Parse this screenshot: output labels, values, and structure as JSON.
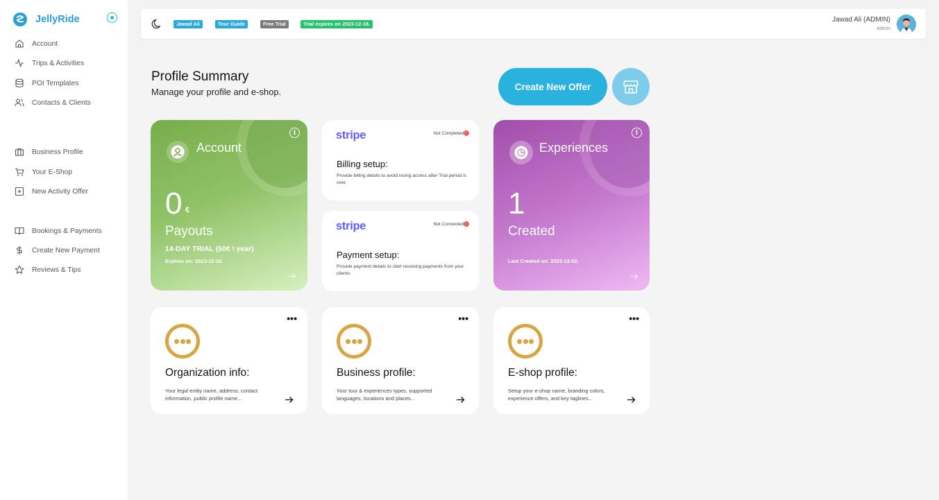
{
  "brand": {
    "name": "JellyRide",
    "accent": "#2a9fd6"
  },
  "sidebar": {
    "items": [
      {
        "label": "Account",
        "icon": "home-icon"
      },
      {
        "label": "Trips & Activities",
        "icon": "activity-icon"
      },
      {
        "label": "POI Templates",
        "icon": "database-icon"
      },
      {
        "label": "Contacts & Clients",
        "icon": "users-icon"
      },
      {
        "label": "Business Profile",
        "icon": "briefcase-icon"
      },
      {
        "label": "Your E-Shop",
        "icon": "cart-icon"
      },
      {
        "label": "New Activity Offer",
        "icon": "plus-square-icon"
      },
      {
        "label": "Bookings & Payments",
        "icon": "book-open-icon"
      },
      {
        "label": "Create New Payment",
        "icon": "dollar-icon"
      },
      {
        "label": "Reviews & Tips",
        "icon": "star-icon"
      }
    ]
  },
  "topbar": {
    "badges": [
      {
        "label": "Jawad Ali",
        "color": "#27a9dd"
      },
      {
        "label": "Tour Guide",
        "color": "#27a9dd"
      },
      {
        "label": "Free Trial",
        "color": "#7a7a7a"
      },
      {
        "label": "Trial expires on 2023-12-18.",
        "color": "#23c26b"
      }
    ],
    "user_name": "Jawad Ali (ADMIN)",
    "user_role": "Admin"
  },
  "page": {
    "title": "Profile Summary",
    "subtitle": "Manage your profile and e-shop.",
    "create_offer_label": "Create New Offer"
  },
  "account_card": {
    "title": "Account",
    "amount": "0",
    "currency": "€",
    "label": "Payouts",
    "trial": "14-DAY TRIAL (50€ \\ year)",
    "expires": "Expires on: 2023-12-16."
  },
  "billing_card": {
    "logo": "stripe",
    "status": "Not Completed",
    "title": "Billing setup:",
    "description": "Provide billing details to avoid losing access after Trial period is over."
  },
  "payment_card": {
    "logo": "stripe",
    "status": "Not Connected",
    "title": "Payment setup:",
    "description": "Provide payment details to start receiving payments from your clients."
  },
  "experiences_card": {
    "title": "Experiences",
    "count": "1",
    "label": "Created",
    "last_created": "Last Created on: 2023-12-02."
  },
  "info_cards": [
    {
      "title": "Organization info:",
      "description": "Your legal entity name, address, contact information, public profile name..."
    },
    {
      "title": "Business profile:",
      "description": "Your tour & experiences types, supported languages, locations and places..."
    },
    {
      "title": "E-shop profile:",
      "description": "Setup your e-shop name, branding colors, experience offers, and key taglines..."
    }
  ]
}
